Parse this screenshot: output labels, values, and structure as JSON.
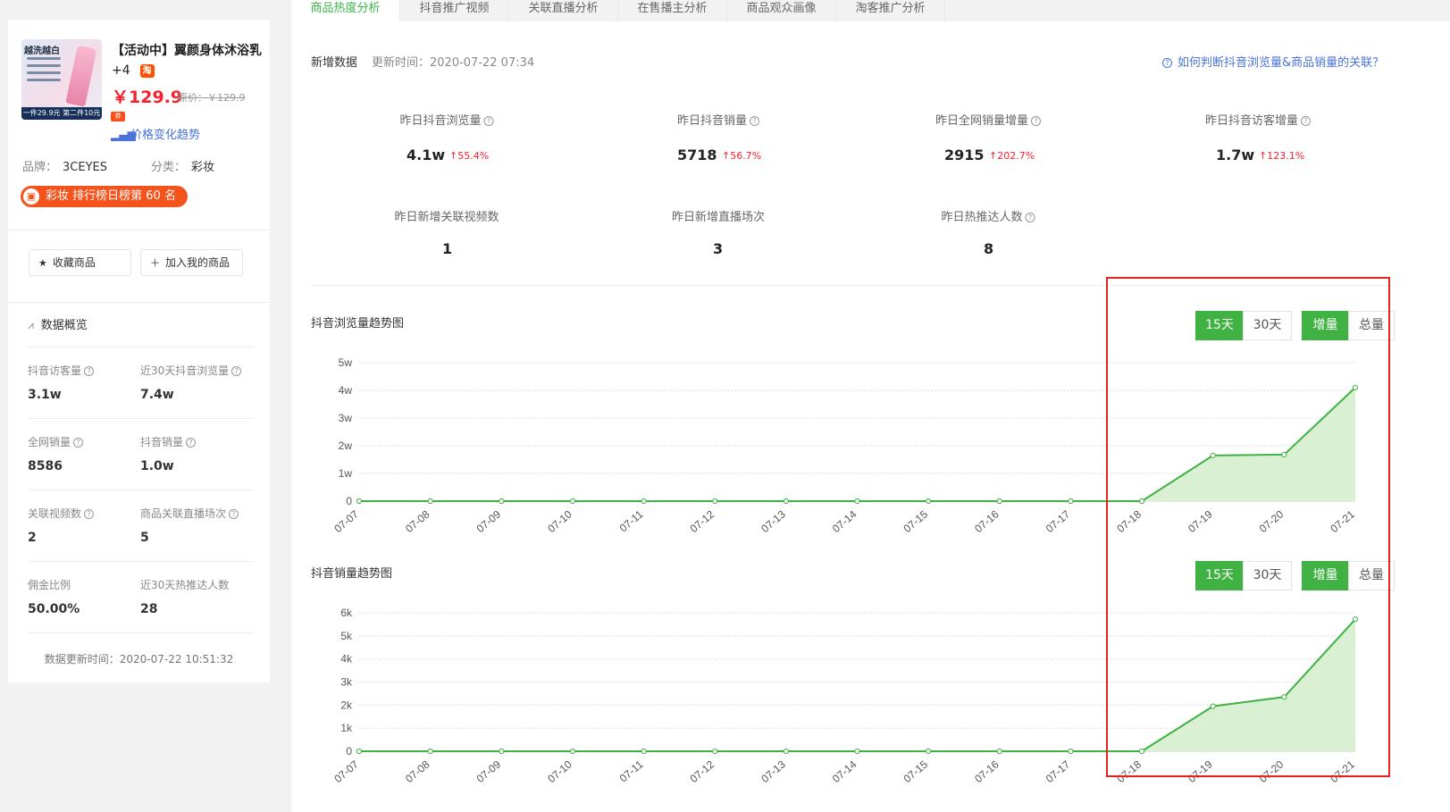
{
  "product": {
    "thumb_badge": "越洗越白",
    "thumb_bar": "一件29.9元 第二件10元",
    "title": "【活动中】翼颜身体沐浴乳",
    "title_extra": "+4",
    "platform_badge": "淘",
    "price": "￥129.9",
    "original_price": "原价：￥129.9",
    "coupon_label": "券",
    "price_trend_link": "价格变化趋势",
    "brand_label": "品牌：",
    "brand": "3CEYES",
    "category_label": "分类：",
    "category": "彩妆",
    "rank": "彩妆 排行榜日榜第 60 名"
  },
  "actions": {
    "favorite": "收藏商品",
    "add_mine": "加入我的商品"
  },
  "overview": {
    "title": "数据概览",
    "stats": [
      {
        "label": "抖音访客量",
        "value": "3.1w"
      },
      {
        "label": "近30天抖音浏览量",
        "value": "7.4w"
      },
      {
        "label": "全网销量",
        "value": "8586"
      },
      {
        "label": "抖音销量",
        "value": "1.0w"
      },
      {
        "label": "关联视频数",
        "value": "2"
      },
      {
        "label": "商品关联直播场次",
        "value": "5"
      },
      {
        "label": "佣金比例",
        "value": "50.00%"
      },
      {
        "label": "近30天热推达人数",
        "value": "28"
      }
    ],
    "updated": "数据更新时间：2020-07-22 10:51:32"
  },
  "tabs": [
    "商品热度分析",
    "抖音推广视频",
    "关联直播分析",
    "在售播主分析",
    "商品观众画像",
    "淘客推广分析"
  ],
  "new_data": {
    "title": "新增数据",
    "updated": "更新时间：2020-07-22 07:34",
    "help_link": "如何判断抖音浏览量&商品销量的关联？",
    "kpis": [
      {
        "label": "昨日抖音浏览量",
        "value": "4.1w",
        "change": "↑55.4%"
      },
      {
        "label": "昨日抖音销量",
        "value": "5718",
        "change": "↑56.7%"
      },
      {
        "label": "昨日全网销量增量",
        "value": "2915",
        "change": "↑202.7%"
      },
      {
        "label": "昨日抖音访客增量",
        "value": "1.7w",
        "change": "↑123.1%"
      },
      {
        "label": "昨日新增关联视频数",
        "value": "1"
      },
      {
        "label": "昨日新增直播场次",
        "value": "3"
      },
      {
        "label": "昨日热推达人数",
        "value": "8"
      }
    ]
  },
  "toggles": {
    "d15": "15天",
    "d30": "30天",
    "inc": "增量",
    "total": "总量"
  },
  "colors": {
    "accent": "#3fb243",
    "link": "#4a73d8",
    "up": "#f5222d",
    "highlight_box": "#e8231e"
  },
  "chart_data": [
    {
      "type": "area",
      "title": "抖音浏览量趋势图",
      "x": [
        "07-07",
        "07-08",
        "07-09",
        "07-10",
        "07-11",
        "07-12",
        "07-13",
        "07-14",
        "07-15",
        "07-16",
        "07-17",
        "07-18",
        "07-19",
        "07-20",
        "07-21"
      ],
      "values": [
        0,
        0,
        0,
        0,
        0,
        0,
        0,
        0,
        0,
        0,
        0,
        0,
        16500,
        16800,
        41000
      ],
      "yticks": [
        "0",
        "1w",
        "2w",
        "3w",
        "4w",
        "5w"
      ],
      "ylim": [
        0,
        50000
      ],
      "grid": true
    },
    {
      "type": "area",
      "title": "抖音销量趋势图",
      "x": [
        "07-07",
        "07-08",
        "07-09",
        "07-10",
        "07-11",
        "07-12",
        "07-13",
        "07-14",
        "07-15",
        "07-16",
        "07-17",
        "07-18",
        "07-19",
        "07-20",
        "07-21"
      ],
      "values": [
        0,
        0,
        0,
        0,
        0,
        0,
        0,
        0,
        0,
        0,
        0,
        0,
        1950,
        2350,
        5718
      ],
      "yticks": [
        "0",
        "1k",
        "2k",
        "3k",
        "4k",
        "5k",
        "6k"
      ],
      "ylim": [
        0,
        6000
      ],
      "grid": true
    }
  ]
}
